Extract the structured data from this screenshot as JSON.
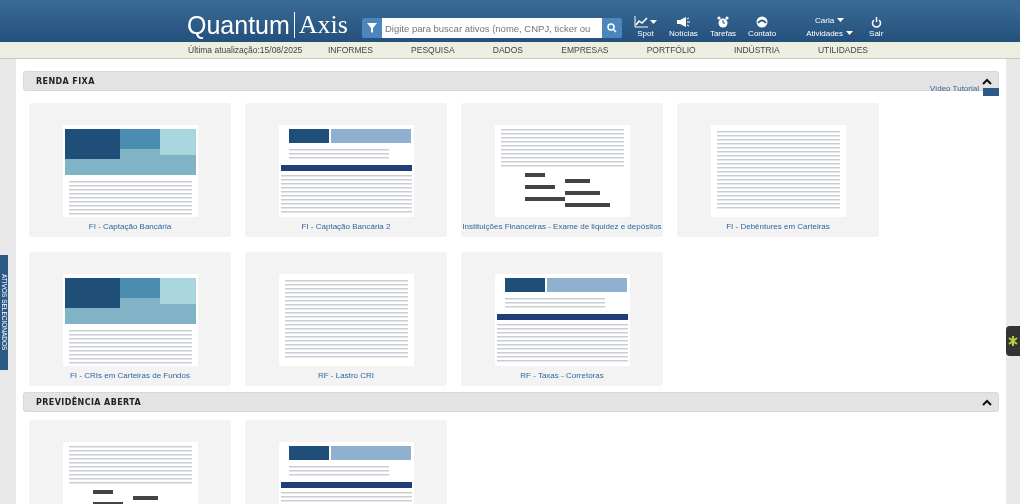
{
  "header": {
    "logo_left": "Quantum",
    "logo_right": "Axis",
    "search": {
      "placeholder": "Digite para buscar ativos (nome, CNPJ, ticker ou"
    },
    "tools": [
      {
        "label": "Spot",
        "dropdown": true,
        "kind": "chart"
      },
      {
        "label": "Notícias",
        "dropdown": false,
        "kind": "megaphone"
      },
      {
        "label": "Tarefas",
        "dropdown": false,
        "kind": "alarm"
      },
      {
        "label": "Contato",
        "dropdown": false,
        "kind": "phone"
      }
    ],
    "user": {
      "name": "Carla",
      "activities": "Atividades"
    },
    "logout": "Sair"
  },
  "nav": {
    "last_update": "Última atualização:15/08/2025",
    "items": [
      "INFORMES",
      "PESQUISA",
      "DADOS",
      "EMPRESAS",
      "PORTFÓLIO",
      "INDÚSTRIA",
      "UTILIDADES"
    ]
  },
  "side_tab": "ATIVOS SELECIONADOS",
  "sections": [
    {
      "title": "RENDA FIXA",
      "expanded": true,
      "tutorial": "Vídeo Tutorial",
      "cards": [
        {
          "caption": "FI - Captação Bancária",
          "kind": "treemap"
        },
        {
          "caption": "FI - Captação Bancária 2",
          "kind": "table"
        },
        {
          "caption": "Instituições Financeiras - Exame de liquidez e depósitos",
          "kind": "bars"
        },
        {
          "caption": "FI - Debêntures em Carteiras",
          "kind": "list"
        },
        {
          "caption": "FI - CRIs em Carteiras de Fundos",
          "kind": "treemap"
        },
        {
          "caption": "RF - Lastro CRI",
          "kind": "list"
        },
        {
          "caption": "RF - Taxas - Corretoras",
          "kind": "table"
        }
      ]
    },
    {
      "title": "PREVIDÊNCIA ABERTA",
      "expanded": true,
      "cards": [
        {
          "kind": "bars"
        },
        {
          "kind": "table"
        }
      ]
    }
  ]
}
